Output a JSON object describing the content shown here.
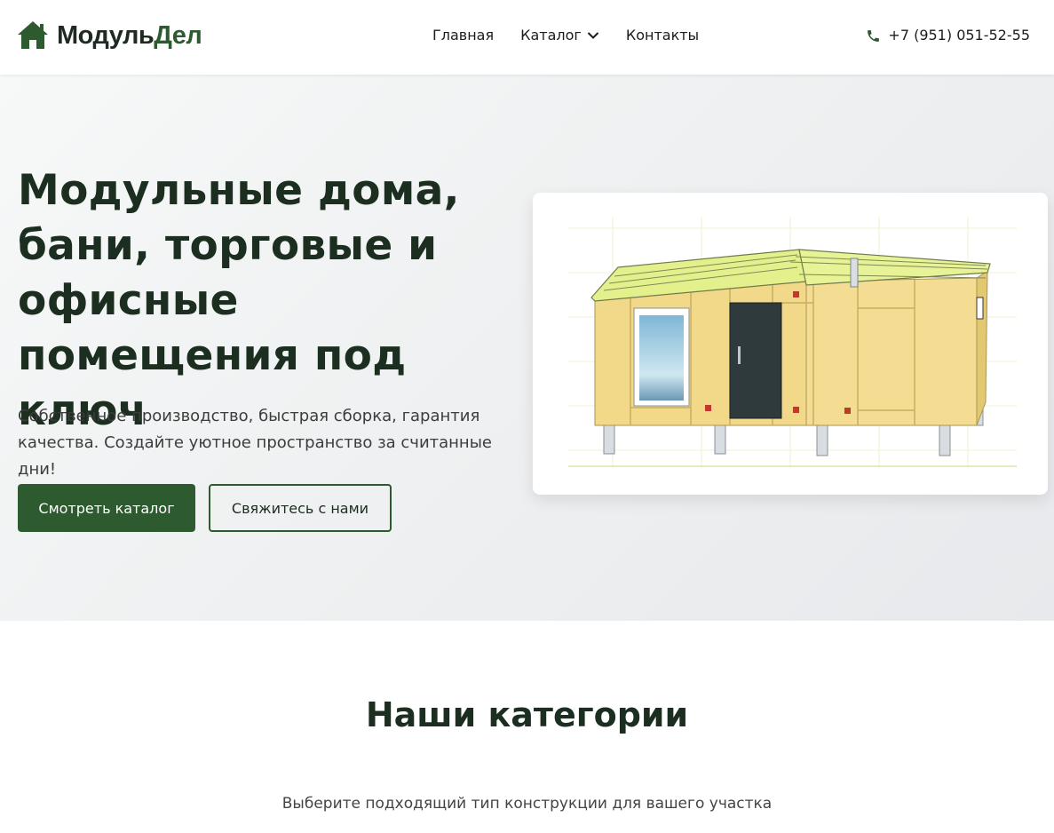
{
  "brand": {
    "part1": "Модуль",
    "part2": "Дел",
    "icon": "house-icon",
    "color": "#2d5a2f"
  },
  "nav": {
    "items": [
      {
        "label": "Главная"
      },
      {
        "label": "Каталог",
        "icon": "chevron-down-icon"
      },
      {
        "label": "Контакты"
      }
    ]
  },
  "contact": {
    "phone": "+7 (951) 051-52-55",
    "icon": "phone-icon"
  },
  "hero": {
    "title": "Модульные дома, бани, торговые и офисные помещения под ключ",
    "subtitle": "Собственное производство, быстрая сборка, гарантия качества. Создайте уютное пространство за считанные дни!",
    "primary_button": "Смотреть каталог",
    "secondary_button": "Свяжитесь с нами",
    "image": "modular-building-drawing"
  },
  "categories": {
    "title": "Наши категории",
    "subtitle": "Выберите подходящий тип конструкции для вашего участка"
  },
  "colors": {
    "accent": "#2d5a2f",
    "heading": "#1b2e20",
    "hero_bg": "#eef0f1"
  }
}
